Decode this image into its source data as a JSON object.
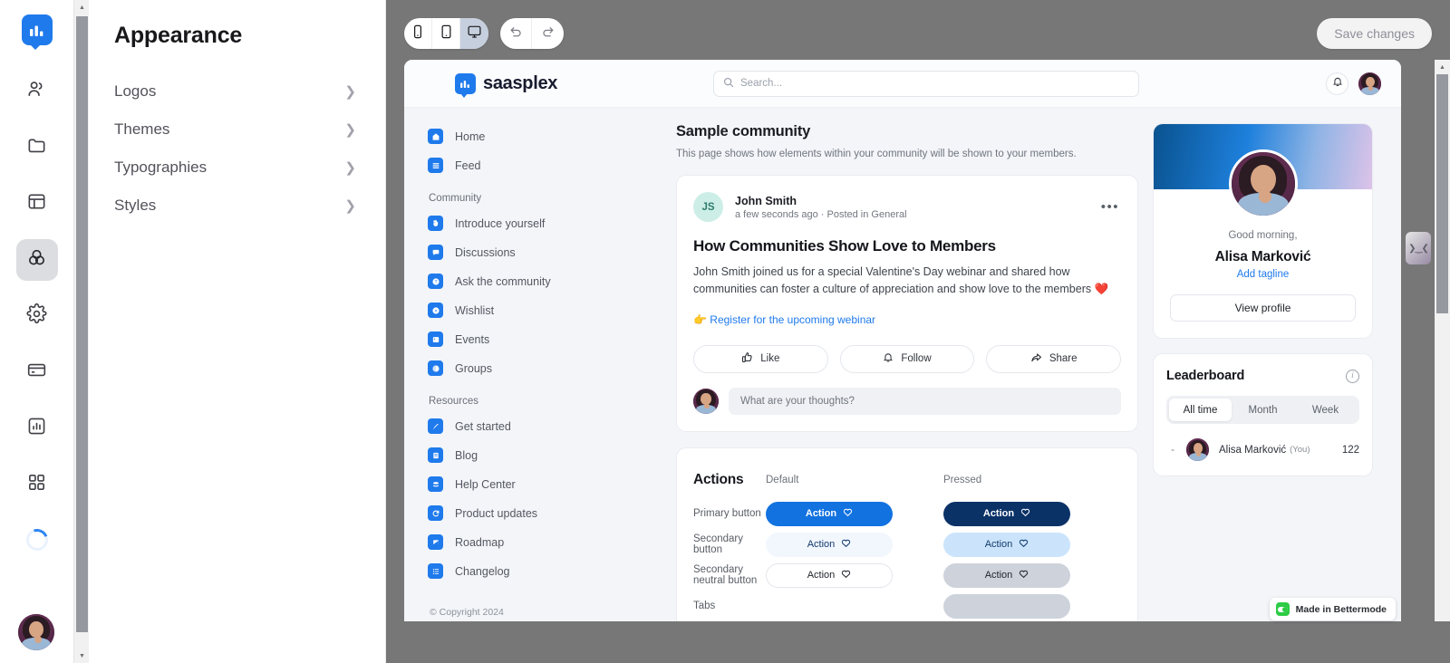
{
  "workspace": {
    "rail": {
      "logo_icon": "saasplex-logo-icon",
      "items": [
        {
          "name": "members",
          "icon": "people-icon",
          "active": false
        },
        {
          "name": "content",
          "icon": "folder-icon",
          "active": false
        },
        {
          "name": "spaces",
          "icon": "layout-icon",
          "active": false
        },
        {
          "name": "appearance",
          "icon": "palette-icon",
          "active": true
        },
        {
          "name": "settings",
          "icon": "gear-icon",
          "active": false
        },
        {
          "name": "billing",
          "icon": "credit-card-icon",
          "active": false
        },
        {
          "name": "analytics",
          "icon": "bar-chart-icon",
          "active": false
        },
        {
          "name": "apps",
          "icon": "grid-icon",
          "active": false
        }
      ],
      "loading_icon": "spinner-icon",
      "avatar_icon": "user-avatar"
    },
    "settings_panel": {
      "title": "Appearance",
      "rows": [
        {
          "label": "Logos"
        },
        {
          "label": "Themes"
        },
        {
          "label": "Typographies"
        },
        {
          "label": "Styles"
        }
      ],
      "chevron_icon": "chevron-right-icon"
    },
    "toolbar": {
      "devices": [
        {
          "name": "mobile",
          "icon": "mobile-icon",
          "active": false
        },
        {
          "name": "tablet",
          "icon": "tablet-icon",
          "active": false
        },
        {
          "name": "desktop",
          "icon": "desktop-icon",
          "active": true
        }
      ],
      "undo_icon": "undo-icon",
      "redo_icon": "redo-icon",
      "save_label": "Save changes"
    }
  },
  "preview": {
    "header": {
      "brand_name": "saasplex",
      "brand_icon": "saasplex-logo-icon",
      "search_placeholder": "Search...",
      "search_icon": "search-icon",
      "bell_icon": "bell-icon",
      "avatar_icon": "user-avatar"
    },
    "sidebar": {
      "top_items": [
        {
          "label": "Home",
          "icon": "home-icon"
        },
        {
          "label": "Feed",
          "icon": "feed-icon"
        }
      ],
      "groups": [
        {
          "title": "Community",
          "items": [
            {
              "label": "Introduce yourself",
              "icon": "wave-hand-icon"
            },
            {
              "label": "Discussions",
              "icon": "chat-bubble-icon"
            },
            {
              "label": "Ask the community",
              "icon": "question-mark-icon"
            },
            {
              "label": "Wishlist",
              "icon": "lightbulb-icon"
            },
            {
              "label": "Events",
              "icon": "calendar-icon"
            },
            {
              "label": "Groups",
              "icon": "groups-icon"
            }
          ]
        },
        {
          "title": "Resources",
          "items": [
            {
              "label": "Get started",
              "icon": "rocket-icon"
            },
            {
              "label": "Blog",
              "icon": "document-icon"
            },
            {
              "label": "Help Center",
              "icon": "stack-icon"
            },
            {
              "label": "Product updates",
              "icon": "refresh-icon"
            },
            {
              "label": "Roadmap",
              "icon": "flag-icon"
            },
            {
              "label": "Changelog",
              "icon": "list-icon"
            }
          ]
        }
      ],
      "copyright": "© Copyright 2024"
    },
    "main": {
      "page_title": "Sample community",
      "page_subtitle": "This page shows how elements within your community will be shown to your members.",
      "post": {
        "author_initials": "JS",
        "author_name": "John Smith",
        "meta": "a few seconds ago · Posted in General",
        "more_icon": "more-horizontal-icon",
        "title": "How Communities Show Love to Members",
        "body": "John Smith joined us for a special Valentine's Day webinar and shared how communities can foster a culture of appreciation and show love to the members ❤️",
        "link": "👉 Register for the upcoming webinar",
        "actions": [
          {
            "label": "Like",
            "icon": "thumbs-up-icon"
          },
          {
            "label": "Follow",
            "icon": "bell-icon"
          },
          {
            "label": "Share",
            "icon": "share-icon"
          }
        ],
        "comment_placeholder": "What are your thoughts?"
      },
      "actions_section": {
        "title": "Actions",
        "col_default": "Default",
        "col_pressed": "Pressed",
        "rows": [
          {
            "label": "Primary button",
            "default_label": "Action",
            "pressed_label": "Action",
            "style": "primary"
          },
          {
            "label": "Secondary button",
            "default_label": "Action",
            "pressed_label": "Action",
            "style": "secondary"
          },
          {
            "label": "Secondary neutral button",
            "default_label": "Action",
            "pressed_label": "Action",
            "style": "neutral"
          }
        ],
        "next_row_label": "Tabs",
        "heart_icon": "heart-icon"
      }
    },
    "right_rail": {
      "profile": {
        "greeting": "Good morning,",
        "name": "Alisa Marković",
        "tagline_link": "Add tagline",
        "view_profile_label": "View profile",
        "avatar_icon": "user-avatar"
      },
      "leaderboard": {
        "title": "Leaderboard",
        "info_icon": "info-icon",
        "tabs": [
          {
            "label": "All time",
            "active": true
          },
          {
            "label": "Month",
            "active": false
          },
          {
            "label": "Week",
            "active": false
          }
        ],
        "rows": [
          {
            "rank": "-",
            "name": "Alisa Marković",
            "you": "(You)",
            "score": "122"
          }
        ]
      }
    },
    "badge": {
      "label": "Made in Bettermode",
      "icon": "bettermode-toggle-icon",
      "color": "#2dcc45"
    },
    "resize_handle_icon": "resize-handle-icon"
  },
  "colors": {
    "brand_blue": "#1f7aec",
    "primary_button": "#1272e0",
    "primary_pressed": "#0b3267",
    "canvas_gray": "#777778",
    "preview_bg": "#f3f5f9"
  }
}
